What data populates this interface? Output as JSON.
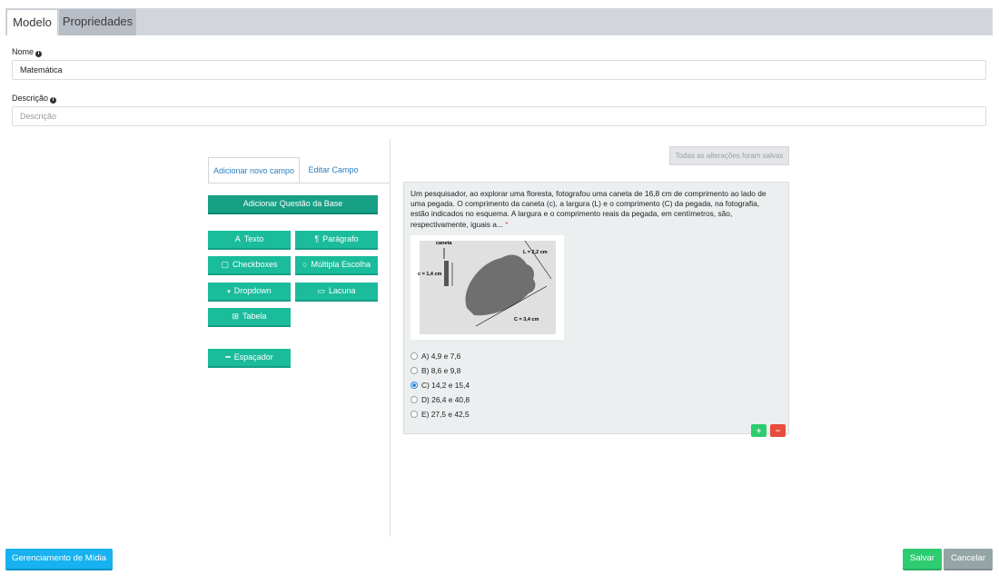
{
  "tabs": {
    "modelo": "Modelo",
    "propriedades": "Propriedades"
  },
  "form": {
    "nome_label": "Nome",
    "nome_value": "Matemática",
    "descricao_label": "Descrição",
    "descricao_placeholder": "Descrição"
  },
  "panel": {
    "tab_add": "Adicionar novo campo",
    "tab_edit": "Editar Campo",
    "add_base": "Adicionar Questão da Base",
    "texto": "Texto",
    "paragrafo": "Parágrafo",
    "checkboxes": "Checkboxes",
    "multipla": "Múltipla Escolha",
    "dropdown": "Dropdown",
    "lacuna": "Lacuna",
    "tabela": "Tabela",
    "espacador": "Espaçador"
  },
  "status": {
    "saved": "Todas as alterações foram salvas"
  },
  "question": {
    "text": "Um pesquisador, ao explorar uma floresta, fotografou uma caneta de 16,8 cm de comprimento ao lado de uma pegada. O comprimento da caneta (c), a largura (L) e o comprimento (C) da pegada, na fotografia, estão indicados no esquema. A largura e o comprimento reais da pegada, em centímetros, são, respectivamente, iguais a...",
    "required_mark": "*",
    "image_labels": {
      "caneta": "caneta",
      "c": "c = 1,4 cm",
      "L": "L = 2,2 cm",
      "C": "C = 3,4 cm"
    },
    "options": [
      "A) 4,9 e 7,6",
      "B) 8,6 e 9,8",
      "C) 14,2 e 15,4",
      "D) 26,4 e 40,8",
      "E) 27,5 e 42,5"
    ],
    "selected_index": 2
  },
  "footer": {
    "media": "Gerenciamento de Mídia",
    "save": "Salvar",
    "cancel": "Cancelar"
  }
}
